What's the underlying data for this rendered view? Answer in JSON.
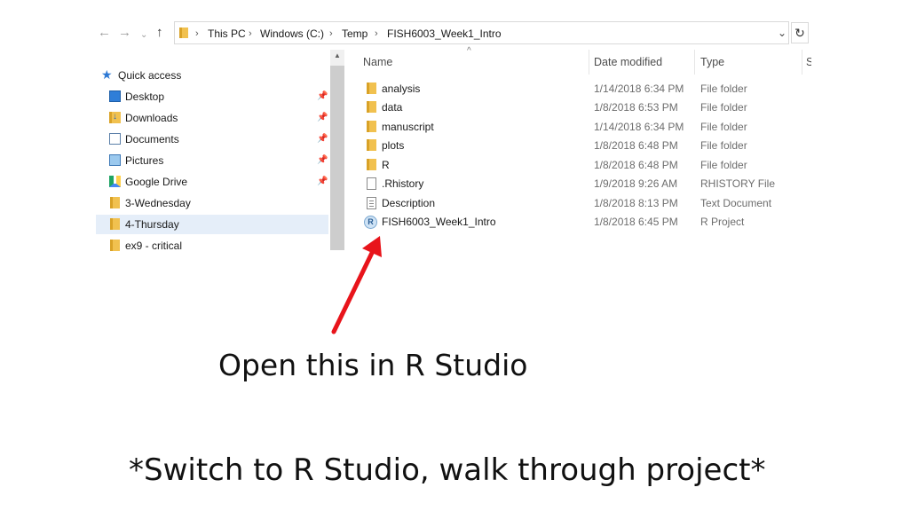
{
  "address_bar": {
    "back": "←",
    "forward": "→",
    "up": "↑",
    "breadcrumbs": [
      "This PC",
      "Windows (C:)",
      "Temp",
      "FISH6003_Week1_Intro"
    ],
    "separator": "›",
    "dropdown": "⌄",
    "refresh": "↻"
  },
  "nav_pane": {
    "quick_access": "Quick access",
    "items": [
      {
        "label": "Desktop",
        "icon": "desktop-icon",
        "pinned": true
      },
      {
        "label": "Downloads",
        "icon": "downloads-icon",
        "pinned": true
      },
      {
        "label": "Documents",
        "icon": "documents-icon",
        "pinned": true
      },
      {
        "label": "Pictures",
        "icon": "pictures-icon",
        "pinned": true
      },
      {
        "label": "Google Drive",
        "icon": "google-drive-icon",
        "pinned": true
      },
      {
        "label": "3-Wednesday",
        "icon": "folder-icon",
        "pinned": false
      },
      {
        "label": "4-Thursday",
        "icon": "folder-icon",
        "pinned": false,
        "selected": true
      },
      {
        "label": "ex9 - critical",
        "icon": "folder-icon",
        "pinned": false
      }
    ],
    "pin_glyph": "📌"
  },
  "columns": {
    "name": "Name",
    "date_modified": "Date modified",
    "type": "Type",
    "size_partial": "S",
    "sort_glyph": "^"
  },
  "files": [
    {
      "name": "analysis",
      "date": "1/14/2018 6:34 PM",
      "type": "File folder",
      "icon": "folder-icon"
    },
    {
      "name": "data",
      "date": "1/8/2018 6:53 PM",
      "type": "File folder",
      "icon": "folder-icon"
    },
    {
      "name": "manuscript",
      "date": "1/14/2018 6:34 PM",
      "type": "File folder",
      "icon": "folder-icon"
    },
    {
      "name": "plots",
      "date": "1/8/2018 6:48 PM",
      "type": "File folder",
      "icon": "folder-icon"
    },
    {
      "name": "R",
      "date": "1/8/2018 6:48 PM",
      "type": "File folder",
      "icon": "folder-icon"
    },
    {
      "name": ".Rhistory",
      "date": "1/9/2018 9:26 AM",
      "type": "RHISTORY File",
      "icon": "file-icon"
    },
    {
      "name": "Description",
      "date": "1/8/2018 8:13 PM",
      "type": "Text Document",
      "icon": "text-document-icon"
    },
    {
      "name": "FISH6003_Week1_Intro",
      "date": "1/8/2018 6:45 PM",
      "type": "R Project",
      "icon": "r-project-icon"
    }
  ],
  "rproj_letter": "R",
  "annotation": {
    "arrow_color": "#e8141b",
    "text": "Open this in R Studio"
  },
  "footer": {
    "text": "*Switch to R Studio, walk through project*"
  }
}
